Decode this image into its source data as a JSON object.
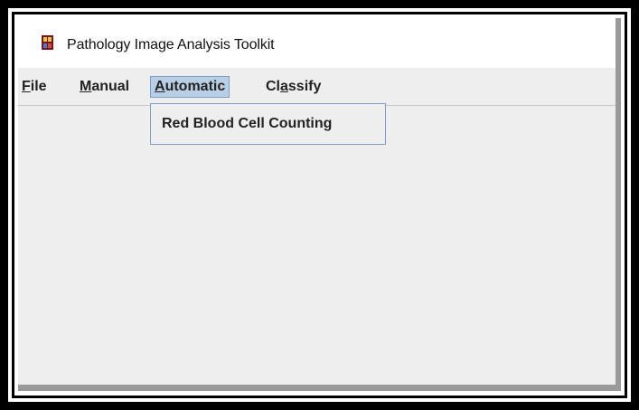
{
  "window": {
    "title": "Pathology Image Analysis Toolkit",
    "icon": "app-logo-icon"
  },
  "menubar": {
    "items": [
      {
        "label_mnemonic": "F",
        "label_rest": "ile"
      },
      {
        "label_mnemonic": "M",
        "label_rest": "anual"
      },
      {
        "label_mnemonic": "A",
        "label_rest": "utomatic"
      },
      {
        "label_pre": "Cl",
        "label_mnemonic": "a",
        "label_rest": "ssify"
      }
    ],
    "open_menu": "Automatic"
  },
  "dropdown": {
    "items": [
      {
        "label": "Red Blood Cell Counting"
      }
    ]
  },
  "colors": {
    "menu_selected_bg": "#b8cfe5",
    "window_bg": "#eeeeee"
  }
}
